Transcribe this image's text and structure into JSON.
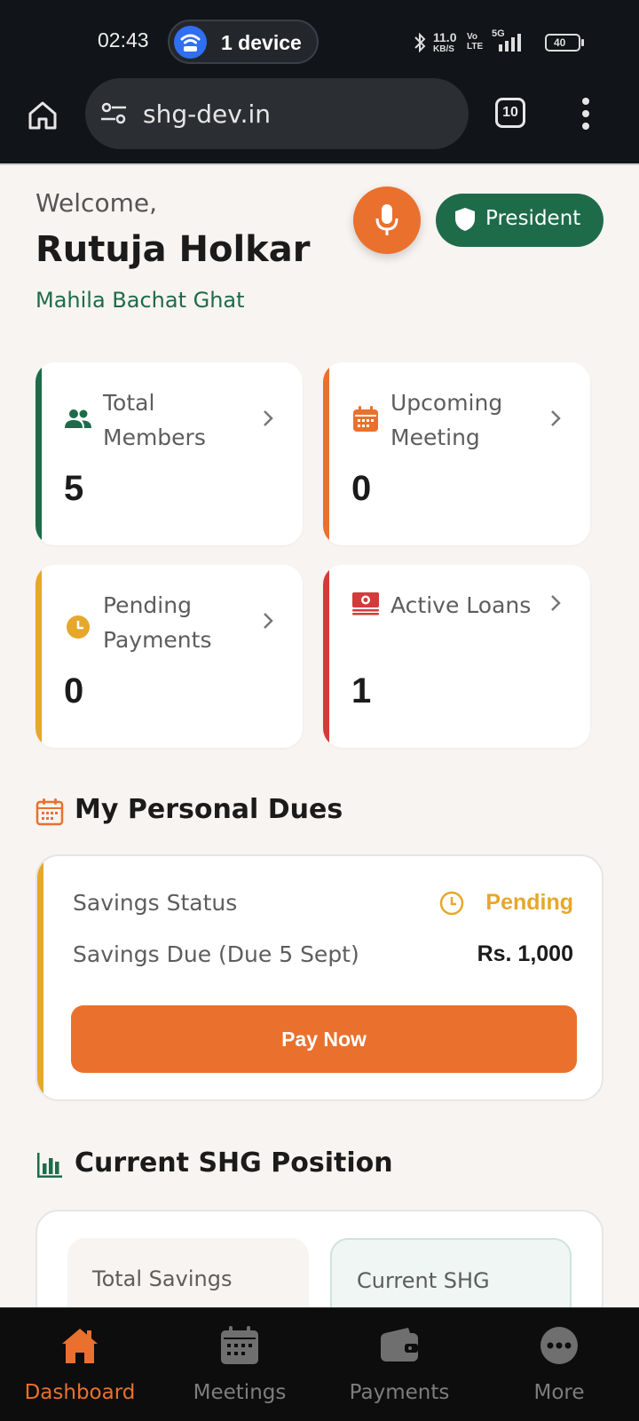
{
  "status_bar": {
    "time": "02:43",
    "hotspot_label": "1 device",
    "speed_value": "11.0",
    "speed_unit": "KB/S",
    "volte": "Vo LTE",
    "network": "5G",
    "battery": "40"
  },
  "browser": {
    "url": "shg-dev.in",
    "tab_count": "10"
  },
  "header": {
    "welcome": "Welcome,",
    "user_name": "Rutuja Holkar",
    "group_name": "Mahila Bachat Ghat",
    "role": "President"
  },
  "stats": [
    {
      "title": "Total Members",
      "value": "5",
      "accent": "#1e6b4a",
      "icon": "members-icon"
    },
    {
      "title": "Upcoming Meeting",
      "value": "0",
      "accent": "#e9712d",
      "icon": "calendar-icon"
    },
    {
      "title": "Pending Payments",
      "value": "0",
      "accent": "#e6a72b",
      "icon": "clock-icon"
    },
    {
      "title": "Active Loans",
      "value": "1",
      "accent": "#d33b3b",
      "icon": "money-icon"
    }
  ],
  "dues": {
    "heading": "My Personal Dues",
    "savings_status_label": "Savings Status",
    "savings_status_value": "Pending",
    "savings_due_label": "Savings Due (Due 5 Sept)",
    "savings_due_amount": "Rs. 1,000",
    "pay_button": "Pay Now"
  },
  "position": {
    "heading": "Current SHG Position",
    "tiles": [
      "Total Savings",
      "Current SHG"
    ]
  },
  "bottom_nav": [
    {
      "label": "Dashboard",
      "icon": "home-icon",
      "active": true
    },
    {
      "label": "Meetings",
      "icon": "calendar-icon",
      "active": false
    },
    {
      "label": "Payments",
      "icon": "wallet-icon",
      "active": false
    },
    {
      "label": "More",
      "icon": "more-icon",
      "active": false
    }
  ],
  "colors": {
    "primary_orange": "#e9712d",
    "primary_green": "#1e6b4a",
    "warning_yellow": "#e6a72b",
    "danger_red": "#d33b3b",
    "background": "#f8f4f1"
  }
}
